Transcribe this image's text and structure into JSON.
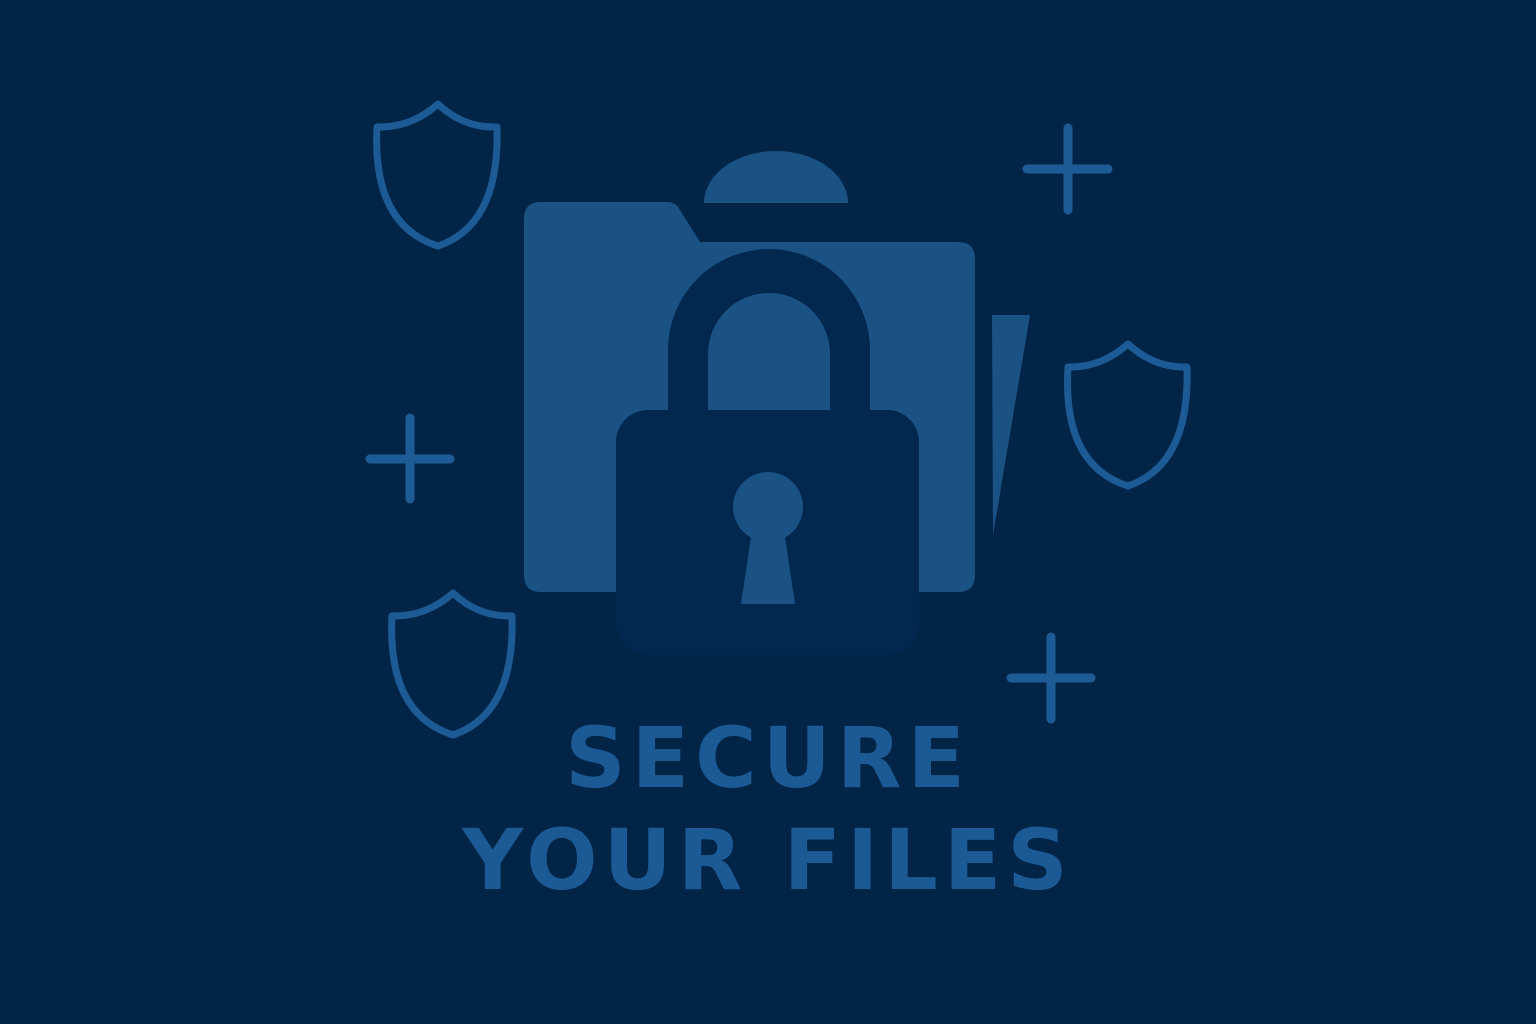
{
  "headline": {
    "line1": "SECURE",
    "line2": "YOUR FILES"
  },
  "colors": {
    "background": "#012447",
    "accent": "#1b5a94",
    "folder": "#1a5284",
    "lock_body": "#022850",
    "outline": "#1d5b96"
  },
  "icons": {
    "main": "folder-icon",
    "lock": "padlock-icon",
    "decorations": [
      "shield-icon",
      "plus-icon",
      "sparkle-icon"
    ]
  }
}
